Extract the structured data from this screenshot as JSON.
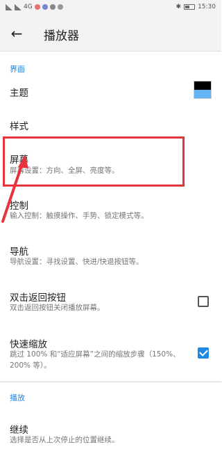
{
  "status_bar": {
    "left_text": "4G",
    "time": "15:30"
  },
  "app_bar": {
    "title": "播放器"
  },
  "sections": {
    "interface": {
      "header": "界面",
      "theme": {
        "title": "主题",
        "swatch_top": "#000000",
        "swatch_bottom": "#64b5f6"
      },
      "style": {
        "title": "样式"
      },
      "screen": {
        "title": "屏幕",
        "summary": "屏幕设置：方向、全屏、亮度等。"
      },
      "control": {
        "title": "控制",
        "summary": "输入控制：触摸操作、手势、锁定模式等。"
      },
      "navigation": {
        "title": "导航",
        "summary": "导航设置：寻找设置、快进/快退按钮等。"
      },
      "double_back": {
        "title": "双击返回按钮",
        "summary": "双击返回按钮关闭播放屏幕。",
        "checked": false
      },
      "fast_zoom": {
        "title": "快速缩放",
        "summary": "跳过 100% 和“适应屏幕”之间的缩放步骤（150%、200% 等）。",
        "checked": true
      }
    },
    "playback": {
      "header": "播放",
      "resume": {
        "title": "继续",
        "summary": "选择是否从上次停止的位置继续。"
      }
    }
  },
  "colors": {
    "accent": "#1e88e5",
    "annotation": "#e8323c"
  }
}
